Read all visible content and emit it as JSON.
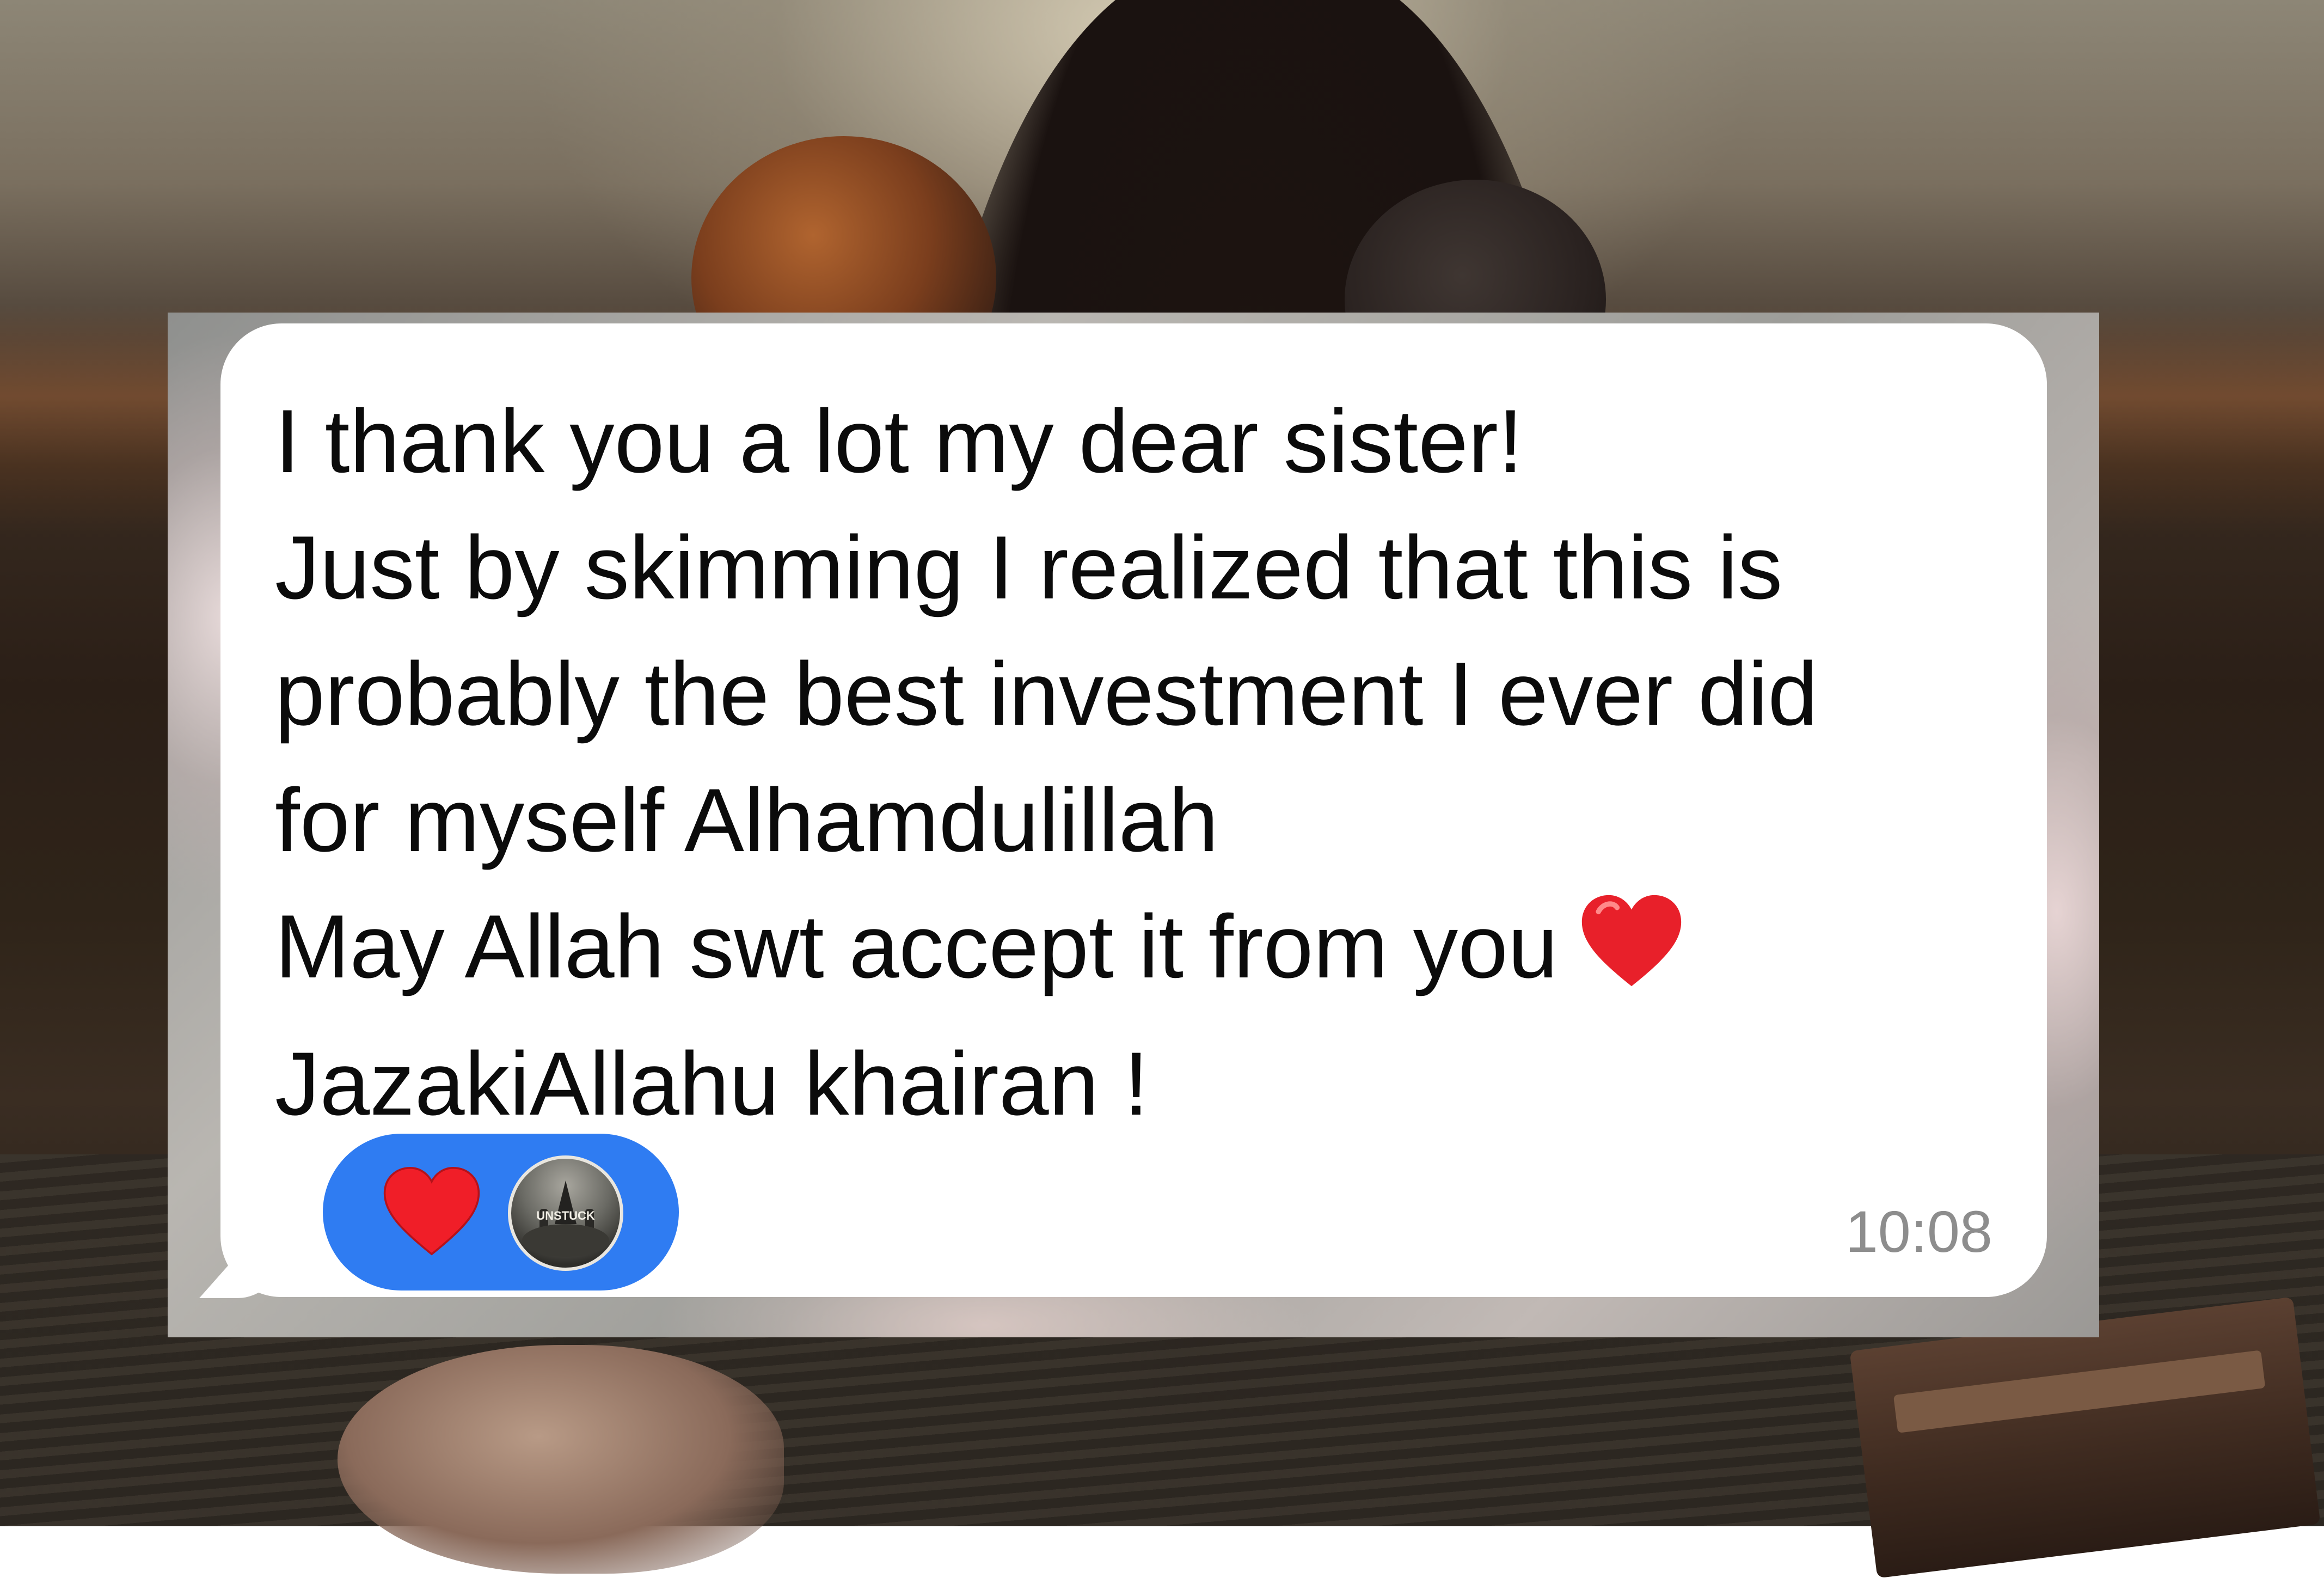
{
  "message": {
    "lines": [
      "I thank you a lot my dear sister!",
      "Just by skimming I realized that this is",
      "probably the best investment I ever did",
      "for myself Alhamdulillah",
      "May Allah swt accept it from you",
      "JazakiAllahu khairan !"
    ],
    "inline_emoji": "red-heart",
    "timestamp": "10:08"
  },
  "reactions": {
    "emoji": "red-heart",
    "avatar_icon": "user-avatar-icon",
    "avatar_text": "UNSTUCK"
  },
  "colors": {
    "bubble": "#ffffff",
    "text": "#0b0b0b",
    "reaction_pill": "#2f7cf2",
    "heart": "#e8202a",
    "timestamp": "#8d8d8d"
  }
}
